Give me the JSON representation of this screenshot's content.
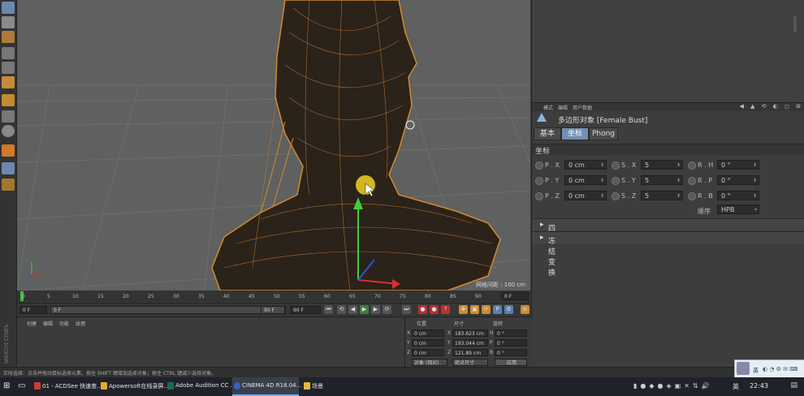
{
  "viewport": {
    "info": "网格间距 : 100 cm",
    "axis_labels": [
      "X",
      "Y",
      "Z"
    ]
  },
  "attr": {
    "menu": [
      "模式",
      "编辑",
      "用户数据"
    ],
    "object_title": "多边形对象 [Female Bust]",
    "tabs": [
      "基本",
      "坐标",
      "Phong"
    ],
    "section_title": "坐标",
    "rows": [
      {
        "p_label": "P . X",
        "p_value": "0 cm",
        "s_label": "S . X",
        "s_value": "5",
        "r_label": "R . H",
        "r_value": "0 °"
      },
      {
        "p_label": "P . Y",
        "p_value": "0 cm",
        "s_label": "S . Y",
        "s_value": "5",
        "r_label": "R . P",
        "r_value": "0 °"
      },
      {
        "p_label": "P . Z",
        "p_value": "0 cm",
        "s_label": "S . Z",
        "s_value": "5",
        "r_label": "R . B",
        "r_value": "0 °"
      }
    ],
    "order_label": "顺序",
    "order_value": "HPB",
    "collapse1": "四元",
    "collapse2": "冻结变换"
  },
  "timeline": {
    "ticks": [
      "0",
      "5",
      "10",
      "15",
      "20",
      "25",
      "30",
      "35",
      "40",
      "45",
      "50",
      "55",
      "60",
      "65",
      "70",
      "75",
      "80",
      "85",
      "90"
    ],
    "end_field": "0 F"
  },
  "controls": {
    "start": "0 F",
    "range_start": "0 F",
    "range_end": "90 F",
    "end": "90 F"
  },
  "material_manager": {
    "menu": [
      "创建",
      "编辑",
      "功能",
      "纹理"
    ]
  },
  "coord_manager": {
    "headers": [
      "位置",
      "尺寸",
      "旋转"
    ],
    "rows": [
      {
        "axis": "X",
        "pos": "0 cm",
        "size_label": "X",
        "size": "183.623 cm",
        "rot_label": "H",
        "rot": "0 °"
      },
      {
        "axis": "Y",
        "pos": "0 cm",
        "size_label": "Y",
        "size": "193.044 cm",
        "rot_label": "P",
        "rot": "0 °"
      },
      {
        "axis": "Z",
        "pos": "0 cm",
        "size_label": "Z",
        "size": "121.89 cm",
        "rot_label": "B",
        "rot": "0 °"
      }
    ],
    "mode_left": "对象 (相对)",
    "mode_mid": "绝对尺寸",
    "apply": "应用"
  },
  "statusbar": {
    "text": "实时选择：点击并拖动鼠标选择元素。按住 SHIFT 键增加选择对象；按住 CTRL 键减少选择对象。"
  },
  "branding": {
    "maxon": "MAXON",
    "cinema": "CINEMA 4D"
  },
  "taskbar": {
    "tasks": [
      {
        "label": "01 - ACDSee 快速查...",
        "color": "#c8402c"
      },
      {
        "label": "Apowersoft在线录屏...",
        "color": "#e8a63a"
      },
      {
        "label": "Adobe Audition CC ...",
        "color": "#1e6b4f"
      },
      {
        "label": "CINEMA 4D R18.04...",
        "color": "#3a5fbf"
      },
      {
        "label": "场景",
        "color": "#e2b640"
      }
    ],
    "ime": "英",
    "clock": "22:43",
    "ime_widget": "英"
  },
  "colors": {
    "accent": "#6f8fb3",
    "wire": "#d08a2e",
    "viewport_bg": "#5f6060"
  }
}
